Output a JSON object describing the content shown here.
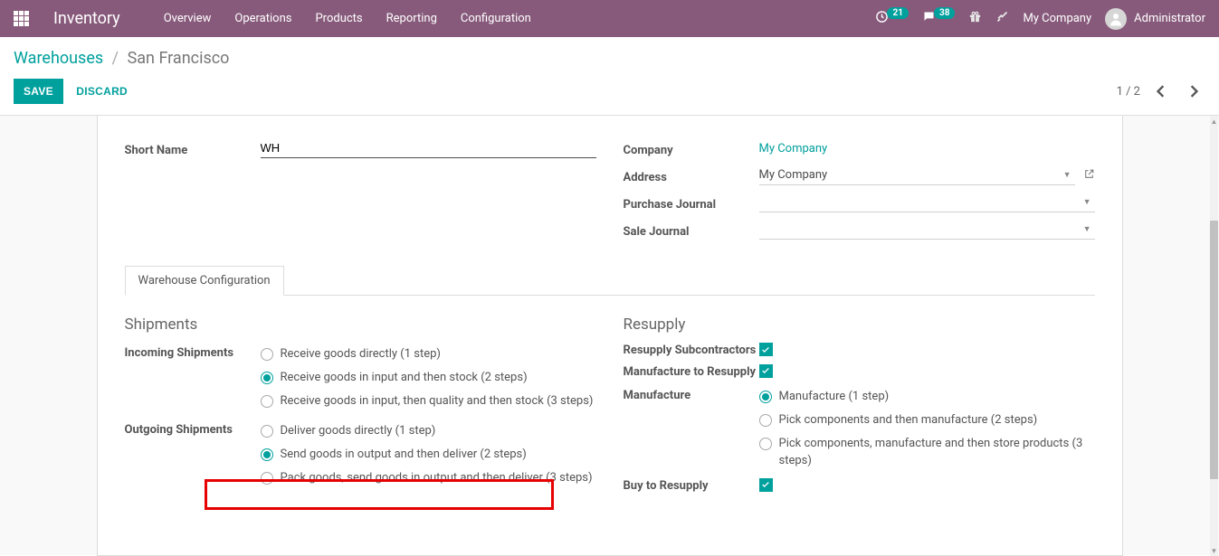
{
  "navbar": {
    "brand": "Inventory",
    "menu": [
      "Overview",
      "Operations",
      "Products",
      "Reporting",
      "Configuration"
    ],
    "badge1": "21",
    "badge2": "38",
    "company": "My Company",
    "user": "Administrator"
  },
  "breadcrumb": {
    "root": "Warehouses",
    "current": "San Francisco"
  },
  "buttons": {
    "save": "SAVE",
    "discard": "DISCARD"
  },
  "pager": {
    "text": "1 / 2"
  },
  "form": {
    "short_name_label": "Short Name",
    "short_name_value": "WH",
    "company_label": "Company",
    "company_value": "My Company",
    "address_label": "Address",
    "address_value": "My Company",
    "purchase_journal_label": "Purchase Journal",
    "sale_journal_label": "Sale Journal"
  },
  "tab": "Warehouse Configuration",
  "sections": {
    "shipments": "Shipments",
    "incoming_label": "Incoming Shipments",
    "incoming_opts": [
      "Receive goods directly (1 step)",
      "Receive goods in input and then stock (2 steps)",
      "Receive goods in input, then quality and then stock (3 steps)"
    ],
    "outgoing_label": "Outgoing Shipments",
    "outgoing_opts": [
      "Deliver goods directly (1 step)",
      "Send goods in output and then deliver (2 steps)",
      "Pack goods, send goods in output and then deliver (3 steps)"
    ],
    "resupply": "Resupply",
    "resupply_sub_label": "Resupply Subcontractors",
    "manuf_resupply_label": "Manufacture to Resupply",
    "manufacture_label": "Manufacture",
    "manufacture_opts": [
      "Manufacture (1 step)",
      "Pick components and then manufacture (2 steps)",
      "Pick components, manufacture and then store products (3 steps)"
    ],
    "buy_resupply_label": "Buy to Resupply"
  }
}
